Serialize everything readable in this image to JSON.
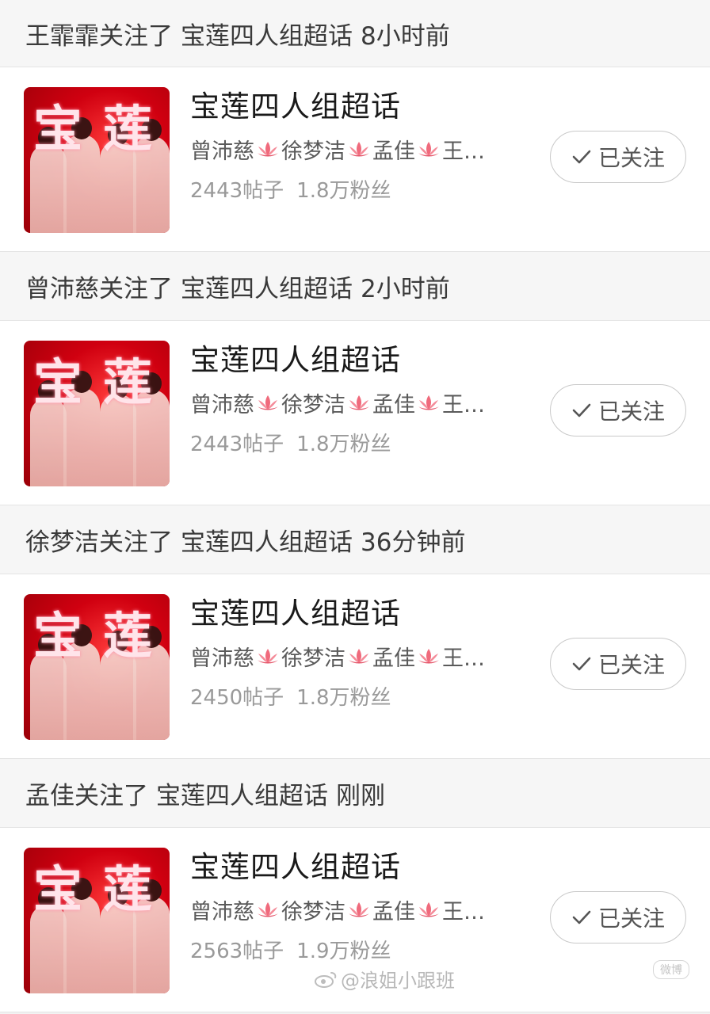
{
  "feed": [
    {
      "header": {
        "actor": "王霏霏关注了",
        "target": "宝莲四人组超话",
        "time": "8小时前"
      },
      "card": {
        "title": "宝莲四人组超话",
        "members": [
          "曾沛慈",
          "徐梦洁",
          "孟佳",
          "王…"
        ],
        "posts": "2443帖子",
        "fans": "1.8万粉丝",
        "button": "已关注"
      }
    },
    {
      "header": {
        "actor": "曾沛慈关注了",
        "target": "宝莲四人组超话",
        "time": "2小时前"
      },
      "card": {
        "title": "宝莲四人组超话",
        "members": [
          "曾沛慈",
          "徐梦洁",
          "孟佳",
          "王…"
        ],
        "posts": "2443帖子",
        "fans": "1.8万粉丝",
        "button": "已关注"
      }
    },
    {
      "header": {
        "actor": "徐梦洁关注了",
        "target": "宝莲四人组超话",
        "time": "36分钟前"
      },
      "card": {
        "title": "宝莲四人组超话",
        "members": [
          "曾沛慈",
          "徐梦洁",
          "孟佳",
          "王…"
        ],
        "posts": "2450帖子",
        "fans": "1.8万粉丝",
        "button": "已关注"
      }
    },
    {
      "header": {
        "actor": "孟佳关注了",
        "target": "宝莲四人组超话",
        "time": "刚刚"
      },
      "card": {
        "title": "宝莲四人组超话",
        "members": [
          "曾沛慈",
          "徐梦洁",
          "孟佳",
          "王…"
        ],
        "posts": "2563帖子",
        "fans": "1.9万粉丝",
        "button": "已关注"
      }
    }
  ],
  "cover_text": [
    "宝",
    "莲"
  ],
  "watermark": "@浪姐小跟班",
  "corner_badge": "微博",
  "icons": {
    "member_separator": "lotus-icon",
    "follow_check": "check-icon",
    "watermark": "weibo-icon"
  },
  "colors": {
    "cover_red": "#d00010",
    "lotus_pink": "#f06a7c",
    "text_dark": "#1a1a1a",
    "text_gray": "#9a9a9a"
  }
}
